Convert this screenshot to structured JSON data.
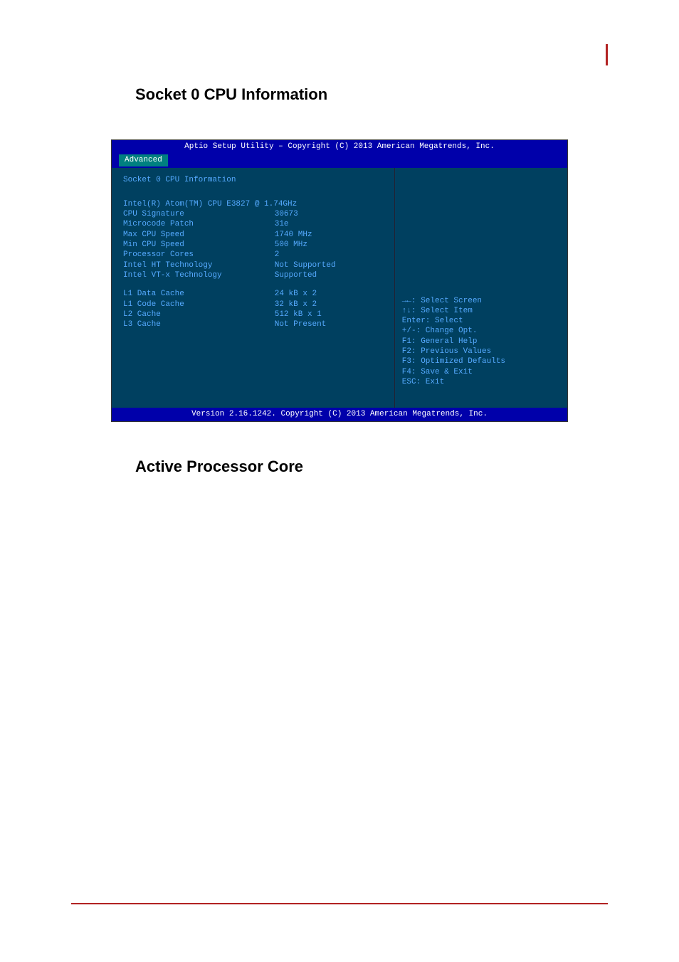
{
  "headings": {
    "section1": "Socket 0 CPU Information",
    "section2": "Active Processor Core"
  },
  "bios": {
    "title": "Aptio Setup Utility – Copyright (C) 2013 American Megatrends, Inc.",
    "active_tab": "Advanced",
    "left": {
      "header": "Socket 0 CPU Information",
      "cpu_name": "Intel(R) Atom(TM) CPU E3827 @ 1.74GHz",
      "rows": [
        {
          "label": "CPU Signature",
          "value": "30673"
        },
        {
          "label": "Microcode Patch",
          "value": "31e"
        },
        {
          "label": "Max CPU Speed",
          "value": "1740 MHz"
        },
        {
          "label": "Min CPU Speed",
          "value": "500 MHz"
        },
        {
          "label": "Processor Cores",
          "value": "2"
        },
        {
          "label": "Intel HT Technology",
          "value": "Not Supported"
        },
        {
          "label": "Intel VT-x Technology",
          "value": "Supported"
        }
      ],
      "cache_rows": [
        {
          "label": "L1 Data Cache",
          "value": "24 kB x 2"
        },
        {
          "label": "L1 Code Cache",
          "value": "32 kB x 2"
        },
        {
          "label": "L2 Cache",
          "value": "512 kB x 1"
        },
        {
          "label": "L3 Cache",
          "value": "Not Present"
        }
      ]
    },
    "help": [
      "→←: Select Screen",
      "↑↓: Select Item",
      "Enter: Select",
      "+/-: Change Opt.",
      "F1: General Help",
      "F2: Previous Values",
      "F3: Optimized Defaults",
      "F4: Save & Exit",
      "ESC: Exit"
    ],
    "footer": "Version 2.16.1242. Copyright (C) 2013 American Megatrends, Inc."
  }
}
